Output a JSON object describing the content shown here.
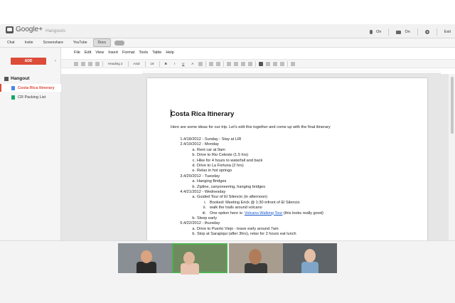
{
  "header": {
    "brand": "Google+",
    "app_title": "Hangouts",
    "mic_label": "On",
    "camera_label": "On",
    "exit_label": "Exit"
  },
  "app_tabs": [
    "Chat",
    "Invite",
    "Screenshare",
    "YouTube",
    "Docs"
  ],
  "sidebar": {
    "add_label": "ADD",
    "hangout_label": "Hangout",
    "docs": [
      {
        "name": "Costa Rica Itinerary",
        "active": true
      },
      {
        "name": "CR Packing List",
        "active": false
      }
    ]
  },
  "menus": [
    "File",
    "Edit",
    "View",
    "Insert",
    "Format",
    "Tools",
    "Table",
    "Help"
  ],
  "toolbar": {
    "style": "Heading 2",
    "font": "Arial",
    "size": "18",
    "bold": "B",
    "italic": "I",
    "underline": "U",
    "text_color": "A"
  },
  "document": {
    "title": "Costa Rica Itinerary",
    "intro": "Here are some ideas for our trip. Let's edit this together and come up with the final itinerary",
    "lines": [
      {
        "marker": "1.",
        "text": "4/18/2012 - Sunday - Stay at LIR",
        "level": 1
      },
      {
        "marker": "2.",
        "text": "4/19/2012 - Monday",
        "level": 1
      },
      {
        "marker": "a.",
        "text": "Rent car at 9am",
        "level": 2
      },
      {
        "marker": "b.",
        "text": "Drive to Rio Celeste (1.5 hrs)",
        "level": 2
      },
      {
        "marker": "c.",
        "text": "Hike for 4 hours to waterfall and back",
        "level": 2
      },
      {
        "marker": "d.",
        "text": "Drive to La Fortuna (2 hrs)",
        "level": 2
      },
      {
        "marker": "e.",
        "text": "Relax in hot springs",
        "level": 2
      },
      {
        "marker": "3.",
        "text": "4/20/2012 - Tuesday",
        "level": 1
      },
      {
        "marker": "a.",
        "text": "Hanging Bridges",
        "level": 2
      },
      {
        "marker": "b.",
        "text": "Zipline, canyoneering, hanging bridges",
        "level": 2
      },
      {
        "marker": "4.",
        "text": "4/21/2012 - Wednesday",
        "level": 1
      },
      {
        "marker": "a.",
        "text": "Guided Tour of El Silencio (in afternoon)",
        "level": 2
      },
      {
        "marker": "i.",
        "text": "Booked: Meeting Erick @ 1:30 infront of El Silencio",
        "level": 3
      },
      {
        "marker": "ii.",
        "text": "walk the trails around volcano",
        "level": 3
      },
      {
        "marker": "iii.",
        "text": "One option here is: ",
        "link": "Volcano Walking Tour",
        "after": " (this looks really good)",
        "level": 3
      },
      {
        "marker": "b.",
        "text": "Sleep early",
        "level": 2
      },
      {
        "marker": "5.",
        "text": "4/22/2012 - thursday",
        "level": 1
      },
      {
        "marker": "a.",
        "text": "Drive to Puerto Viejo - leave early around 7am",
        "level": 2
      },
      {
        "marker": "b.",
        "text": "Stop at Sarapiqui (after 3hrs), relax for 2 hours eat lunch",
        "level": 2
      }
    ]
  },
  "colors": {
    "accent_red": "#dd4b39",
    "link_blue": "#1155cc",
    "doc_blue": "#4a86e8",
    "sheet_green": "#16a765"
  }
}
